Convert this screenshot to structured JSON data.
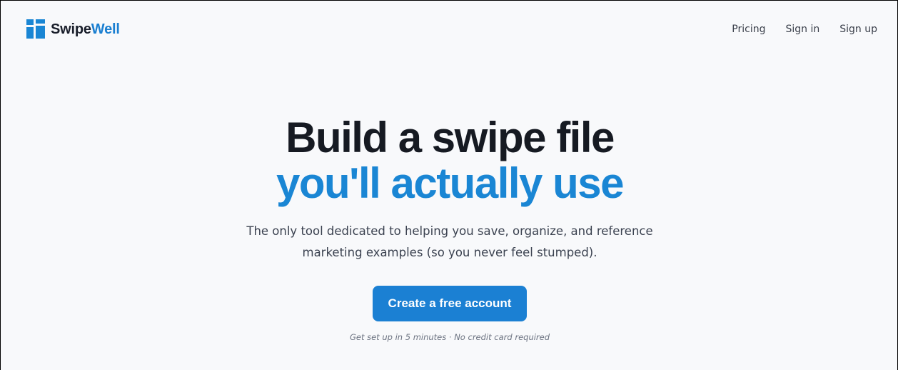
{
  "brand": {
    "name_part1": "Swipe",
    "name_part2": "Well",
    "accent": "#1a86d4",
    "icon": "swipewell-logo-mark"
  },
  "nav": {
    "items": [
      {
        "label": "Pricing"
      },
      {
        "label": "Sign in"
      },
      {
        "label": "Sign up"
      }
    ]
  },
  "hero": {
    "headline_line1": "Build a swipe file",
    "headline_line2": "you'll actually use",
    "subtitle_line1": "The only tool dedicated to helping you save, organize, and reference",
    "subtitle_line2": "marketing examples (so you never feel stumped).",
    "cta_label": "Create a free account",
    "note": "Get set up in 5 minutes · No credit card required"
  },
  "colors": {
    "background": "#f8f9fb",
    "headline_dark": "#161a22",
    "headline_accent": "#1a86d4",
    "button": "#1b80d3"
  }
}
